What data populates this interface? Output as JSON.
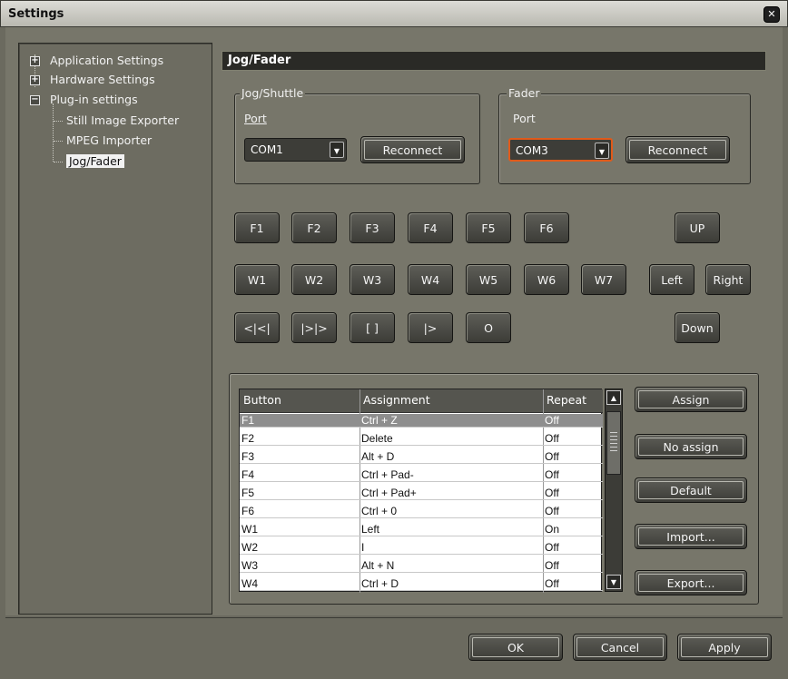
{
  "window": {
    "title": "Settings"
  },
  "tree": {
    "items": [
      {
        "label": "Application Settings",
        "expander": "+"
      },
      {
        "label": "Hardware Settings",
        "expander": "+"
      },
      {
        "label": "Plug-in settings",
        "expander": "−"
      },
      {
        "label": "Still Image Exporter"
      },
      {
        "label": "MPEG Importer"
      },
      {
        "label": "Jog/Fader"
      }
    ]
  },
  "panel": {
    "title": "Jog/Fader"
  },
  "jog": {
    "group_title": "Jog/Shuttle",
    "port_label": "Port",
    "port_value": "COM1",
    "reconnect": "Reconnect"
  },
  "fader": {
    "group_title": "Fader",
    "port_label": "Port",
    "port_value": "COM3",
    "reconnect": "Reconnect"
  },
  "keys": {
    "row1": [
      "F1",
      "F2",
      "F3",
      "F4",
      "F5",
      "F6"
    ],
    "row2": [
      "W1",
      "W2",
      "W3",
      "W4",
      "W5",
      "W6",
      "W7"
    ],
    "row3": [
      "<|<|",
      "|>|>",
      "[ ]",
      "|>",
      "O"
    ],
    "dir": {
      "up": "UP",
      "left": "Left",
      "right": "Right",
      "down": "Down"
    }
  },
  "table": {
    "headers": [
      "Button",
      "Assignment",
      "Repeat"
    ],
    "rows": [
      {
        "button": "F1",
        "assignment": "Ctrl + Z",
        "repeat": "Off"
      },
      {
        "button": "F2",
        "assignment": "Delete",
        "repeat": "Off"
      },
      {
        "button": "F3",
        "assignment": "Alt + D",
        "repeat": "Off"
      },
      {
        "button": "F4",
        "assignment": "Ctrl + Pad-",
        "repeat": "Off"
      },
      {
        "button": "F5",
        "assignment": "Ctrl + Pad+",
        "repeat": "Off"
      },
      {
        "button": "F6",
        "assignment": "Ctrl + 0",
        "repeat": "Off"
      },
      {
        "button": "W1",
        "assignment": "Left",
        "repeat": "On"
      },
      {
        "button": "W2",
        "assignment": "I",
        "repeat": "Off"
      },
      {
        "button": "W3",
        "assignment": "Alt + N",
        "repeat": "Off"
      },
      {
        "button": "W4",
        "assignment": "Ctrl + D",
        "repeat": "Off"
      }
    ]
  },
  "actions": {
    "assign": "Assign",
    "no_assign": "No assign",
    "default": "Default",
    "import": "Import...",
    "export": "Export..."
  },
  "footer": {
    "ok": "OK",
    "cancel": "Cancel",
    "apply": "Apply"
  },
  "colors": {
    "fader_focus": "#e05a1a",
    "selected_row": "#8e8e8e"
  }
}
